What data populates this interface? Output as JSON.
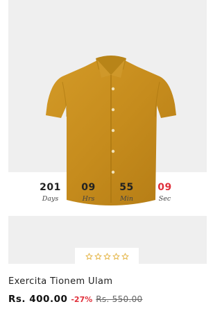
{
  "product": {
    "title": "Exercita Tionem Ulam",
    "price": "Rs. 400.00",
    "discount": "-27%",
    "old_price": "Rs. 550.00",
    "rating": 0,
    "rating_max": 5,
    "image_icon": "shirt-image"
  },
  "countdown": {
    "days": {
      "value": "201",
      "label": "Days"
    },
    "hours": {
      "value": "09",
      "label": "Hrs"
    },
    "minutes": {
      "value": "55",
      "label": "Min"
    },
    "seconds": {
      "value": "09",
      "label": "Sec"
    }
  },
  "colors": {
    "accent_red": "#e0303b",
    "shirt": "#c8911f",
    "star_outline": "#e3b13c",
    "image_bg": "#efefef"
  }
}
